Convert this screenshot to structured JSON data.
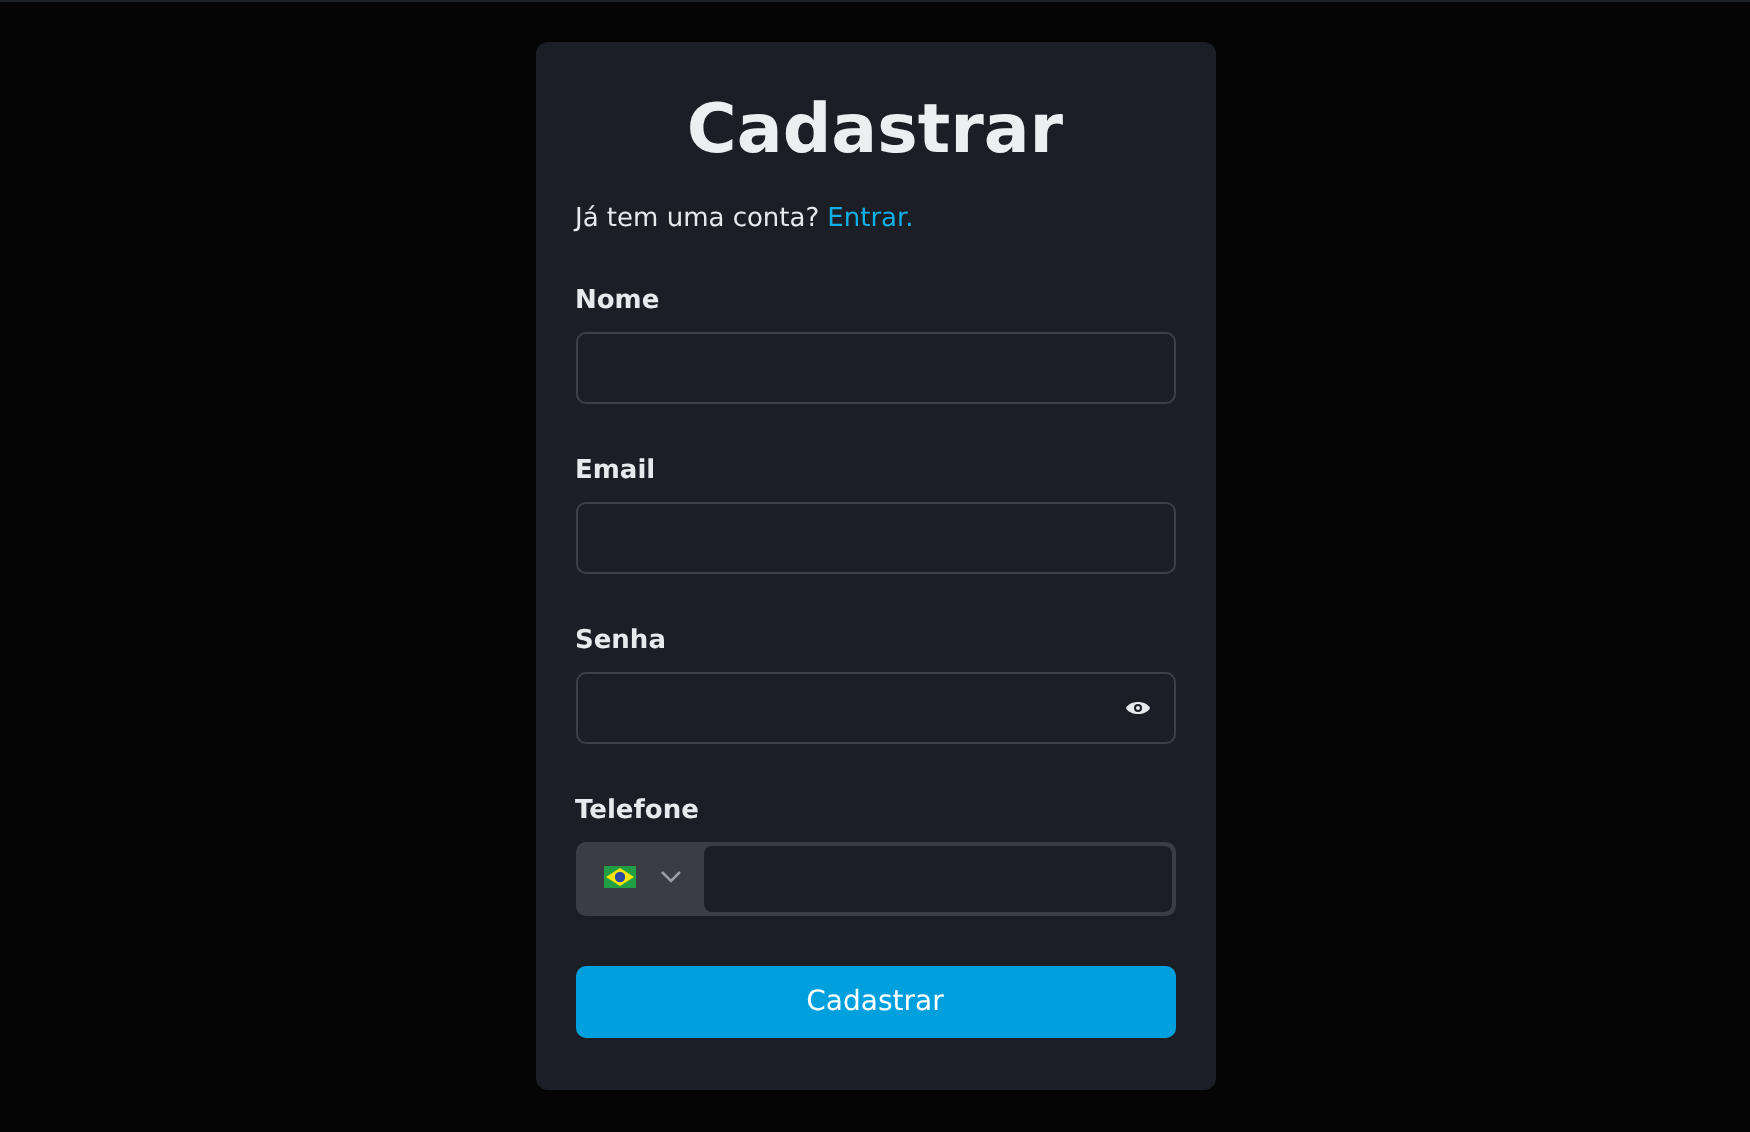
{
  "title": "Cadastrar",
  "login_prompt": {
    "text": "Já tem uma conta?",
    "link": "Entrar."
  },
  "fields": [
    {
      "label": "Nome",
      "kind": "text"
    },
    {
      "label": "Email",
      "kind": "text"
    },
    {
      "label": "Senha",
      "kind": "password"
    },
    {
      "label": "Telefone",
      "kind": "phone"
    }
  ],
  "submit_button": "Cadastrar"
}
